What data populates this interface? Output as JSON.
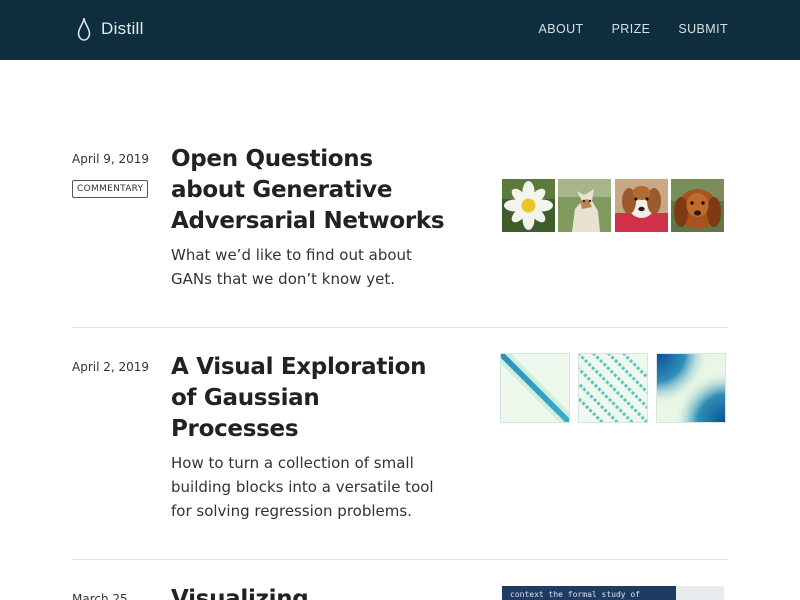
{
  "site": {
    "name": "Distill",
    "nav": [
      "ABOUT",
      "PRIZE",
      "SUBMIT"
    ]
  },
  "posts": [
    {
      "date": "April 9, 2019",
      "badge": "COMMENTARY",
      "title": "Open Questions about Generative Adversarial Networks",
      "description": "What we’d like to find out about GANs that we don’t know yet."
    },
    {
      "date": "April 2, 2019",
      "title": "A Visual Exploration of Gaussian Processes",
      "description": "How to turn a collection of small building blocks into a versatile tool for solving regression problems."
    },
    {
      "date": "March 25",
      "title": "Visualizing",
      "thumb_text": "context the formal study of"
    }
  ],
  "colors": {
    "header_bg": "#0f2e3d",
    "header_text": "#d7e0e4"
  },
  "icons": {
    "logo": "droplet-icon"
  }
}
